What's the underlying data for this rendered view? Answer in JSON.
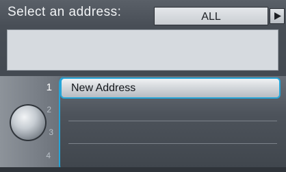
{
  "header": {
    "title": "Select an address:",
    "filter_value": "ALL"
  },
  "list": {
    "selected_index": 1,
    "rows": [
      {
        "number": "1",
        "label": "New Address"
      },
      {
        "number": "2",
        "label": ""
      },
      {
        "number": "3",
        "label": ""
      },
      {
        "number": "4",
        "label": ""
      }
    ]
  },
  "colors": {
    "accent": "#25a5d8",
    "preview": "#d6dadf"
  }
}
